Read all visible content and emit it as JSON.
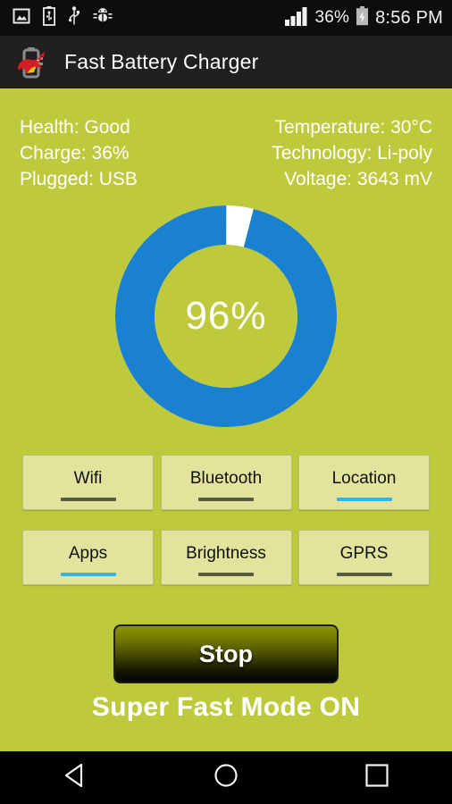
{
  "status_bar": {
    "left_icons": [
      {
        "name": "image-icon",
        "label": "screenshot"
      },
      {
        "name": "usb-battery-icon",
        "label": "usb charging"
      },
      {
        "name": "usb-icon",
        "label": "usb connected"
      },
      {
        "name": "android-debug-bug-icon",
        "label": "usb debugging"
      }
    ],
    "signal_icon": "signal-bars-icon",
    "battery_percent": "36%",
    "battery_icon": "charging-battery-icon",
    "clock": "8:56 PM"
  },
  "app_bar": {
    "icon": "red-bull-battery-app-icon",
    "title": "Fast Battery Charger"
  },
  "info": {
    "left": [
      "Health: Good",
      "Charge: 36%",
      "Plugged: USB"
    ],
    "right": [
      "Temperature: 30°C",
      "Technology: Li-poly",
      "Voltage: 3643 mV"
    ]
  },
  "gauge": {
    "value_label": "96%",
    "percent": 96,
    "ring_color": "#1a80d0",
    "gap_color": "#ffffff",
    "text_color": "#ffffff"
  },
  "toggles": {
    "on_color": "#33b5e5",
    "off_color": "#575b43",
    "rows": [
      [
        {
          "label": "Wifi",
          "state": "off"
        },
        {
          "label": "Bluetooth",
          "state": "off"
        },
        {
          "label": "Location",
          "state": "on"
        }
      ],
      [
        {
          "label": "Apps",
          "state": "on"
        },
        {
          "label": "Brightness",
          "state": "off"
        },
        {
          "label": "GPRS",
          "state": "off"
        }
      ]
    ]
  },
  "action_button": {
    "label": "Stop"
  },
  "mode_status": "Super Fast Mode ON",
  "nav_bar": {
    "back": "back-triangle-icon",
    "home": "home-circle-icon",
    "recents": "recents-square-icon"
  },
  "colors": {
    "background": "#bfc93c",
    "app_bar": "#221f1f",
    "status_bar": "#0d0d0d",
    "button_face": "#e2e49e"
  }
}
